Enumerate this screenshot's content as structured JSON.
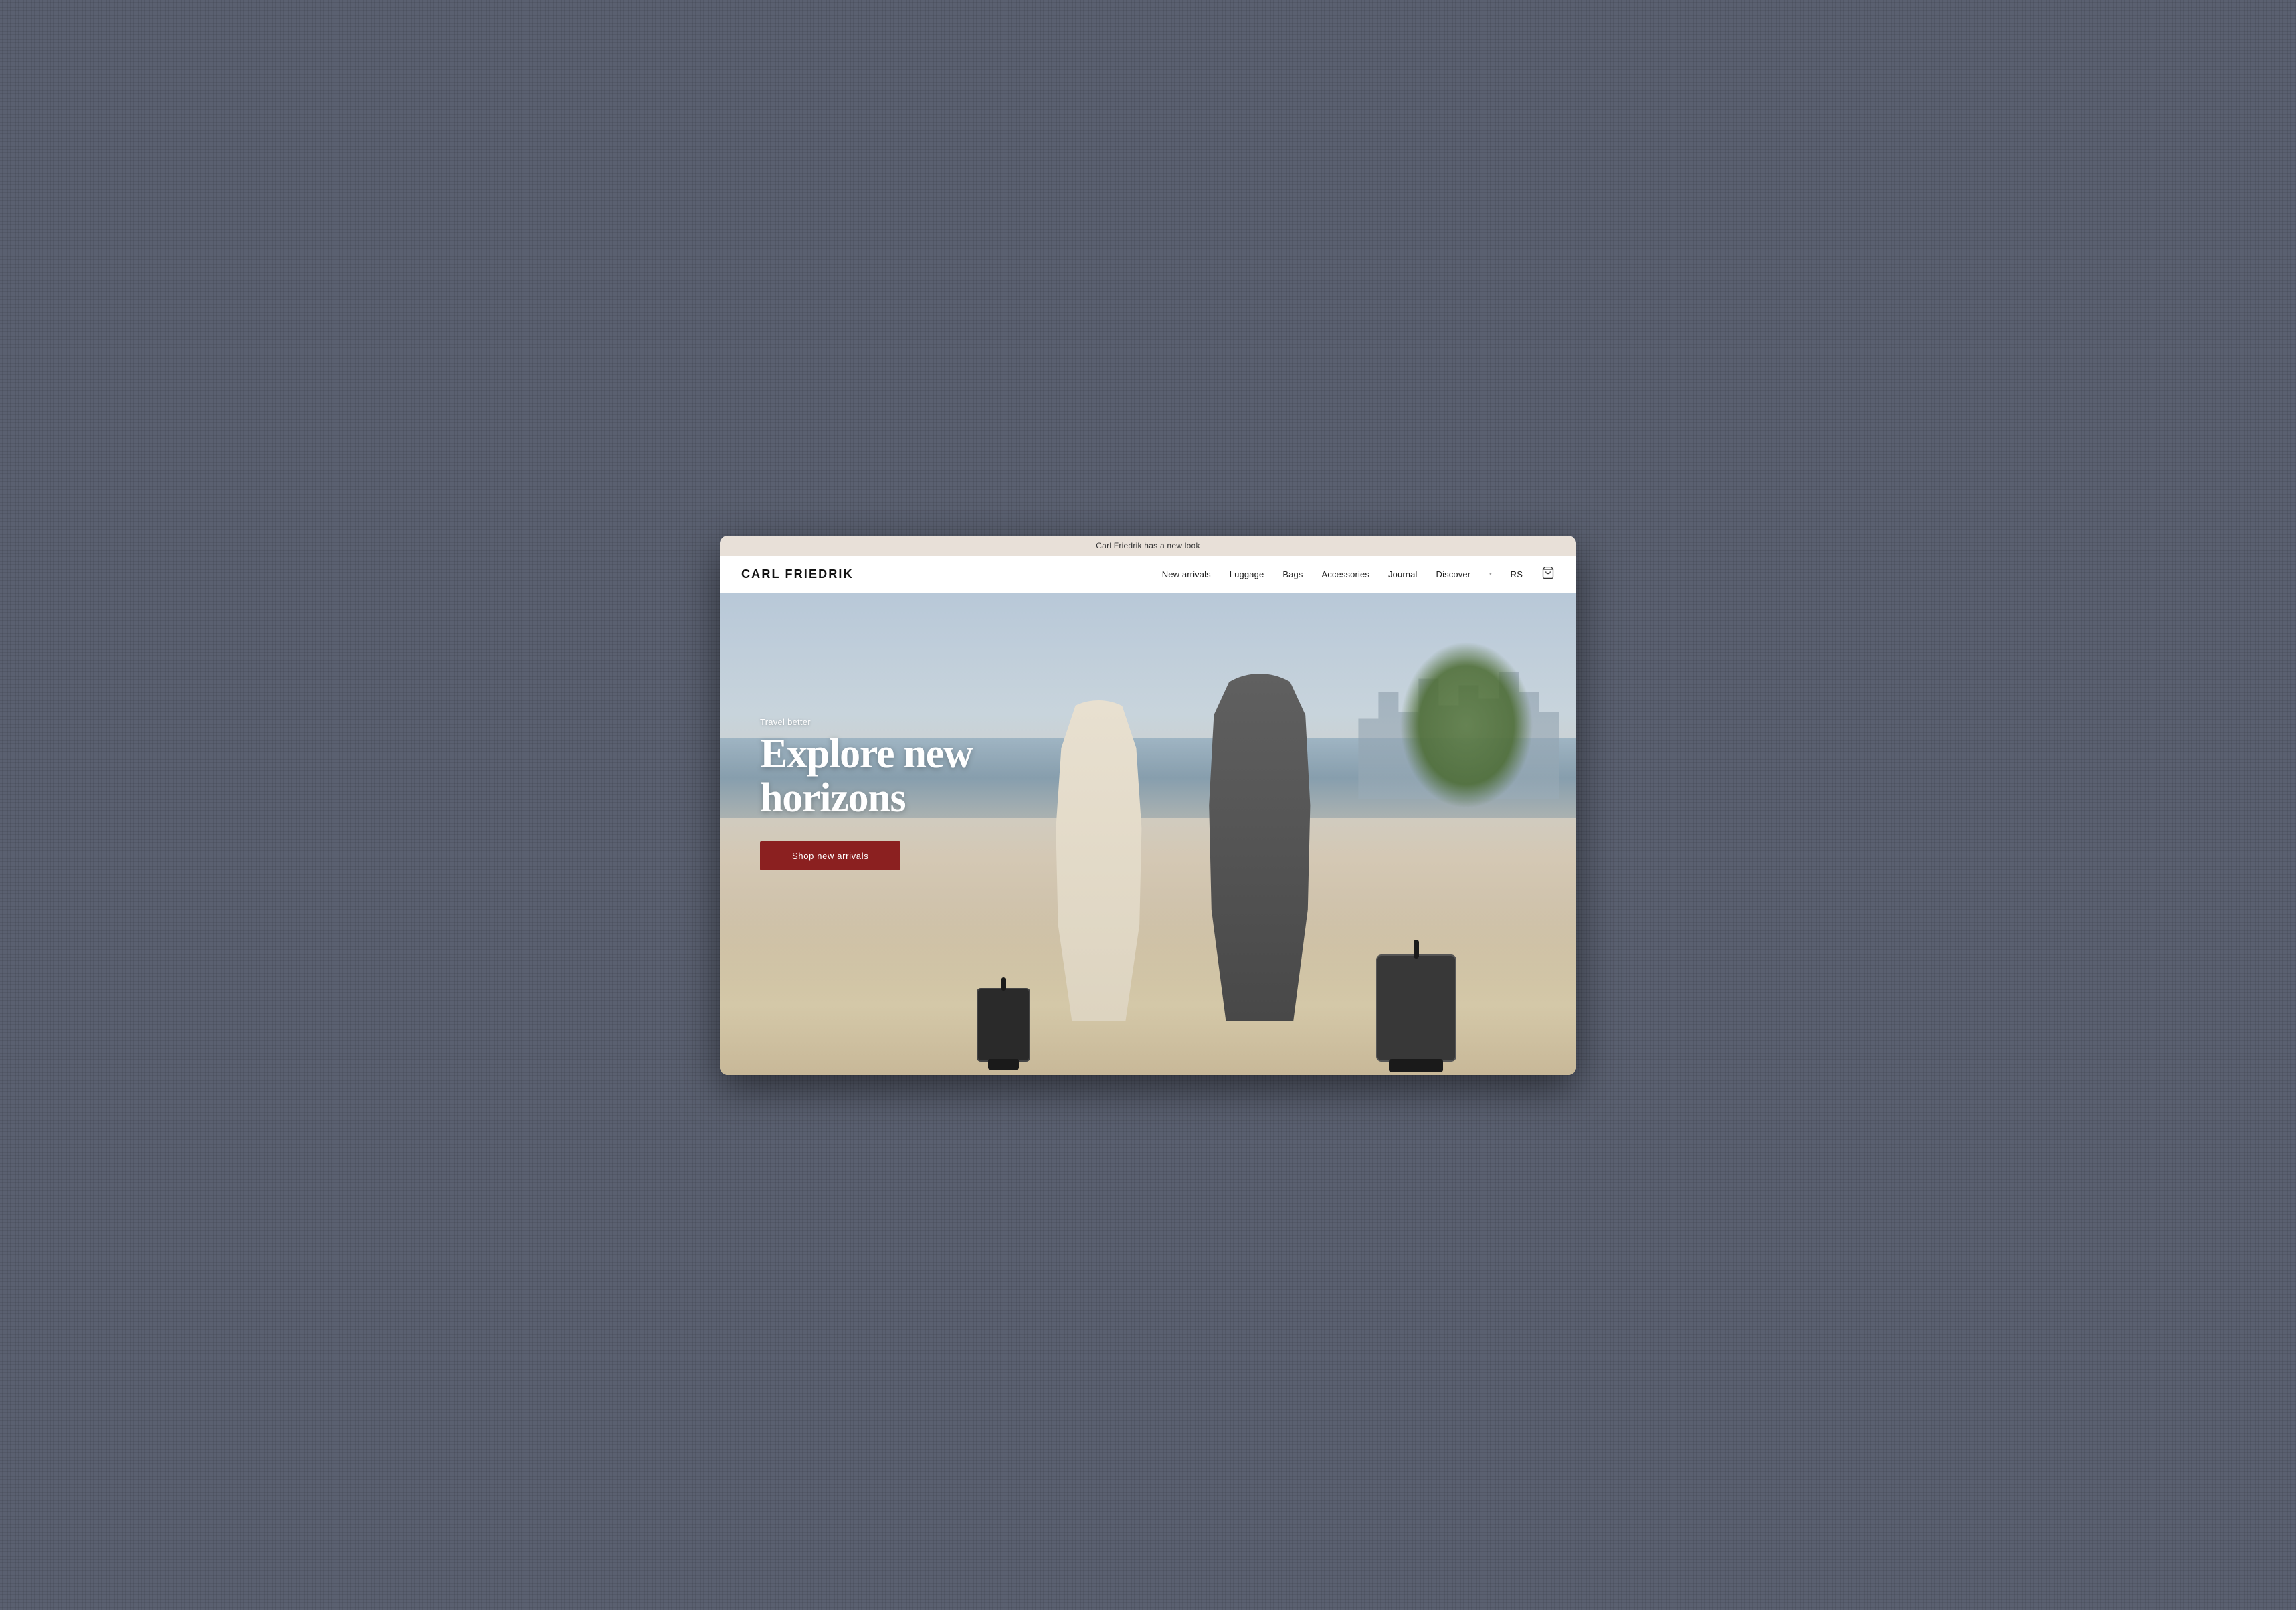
{
  "announcement": {
    "text": "Carl Friedrik has a new look"
  },
  "navbar": {
    "logo": "CARL FRIEDRIK",
    "nav_items": [
      {
        "label": "New arrivals",
        "id": "new-arrivals"
      },
      {
        "label": "Luggage",
        "id": "luggage"
      },
      {
        "label": "Bags",
        "id": "bags"
      },
      {
        "label": "Accessories",
        "id": "accessories"
      },
      {
        "label": "Journal",
        "id": "journal"
      },
      {
        "label": "Discover",
        "id": "discover"
      }
    ],
    "locale": "RS",
    "cart_icon": "🛒"
  },
  "hero": {
    "eyebrow": "Travel better",
    "title": "Explore new horizons",
    "cta_label": "Shop new arrivals"
  }
}
